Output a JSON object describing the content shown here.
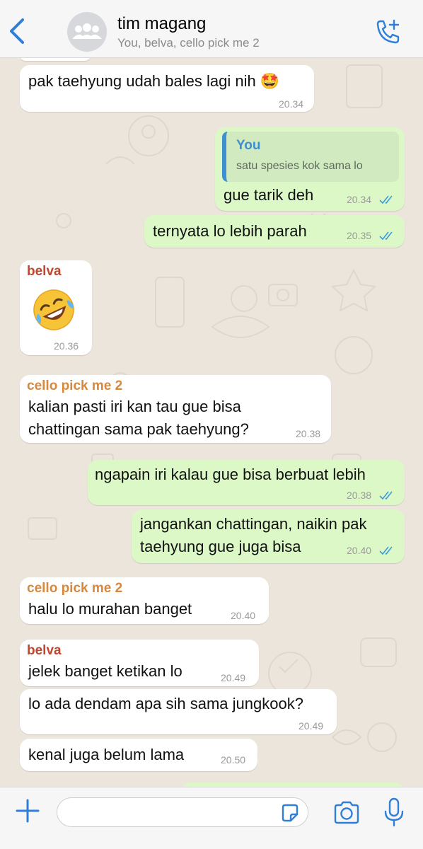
{
  "header": {
    "back_icon": "chevron-left-icon",
    "title": "tim magang",
    "subtitle": "You, belva, cello pick me 2",
    "avatar_icon": "group-icon",
    "call_icon": "add-call-icon",
    "accent": "#2f7fd9"
  },
  "messages": [
    {
      "dir": "in",
      "text": "pak taehyung udah bales lagi nih 🤩",
      "time": "20.34"
    },
    {
      "dir": "out",
      "quote_name": "You",
      "quote_text": "satu spesies kok sama lo",
      "text": "gue tarik deh",
      "time": "20.34",
      "read": true
    },
    {
      "dir": "out",
      "text": "ternyata lo lebih parah",
      "time": "20.35",
      "read": true
    },
    {
      "dir": "in",
      "sender": "belva",
      "sender_color": "#c0462e",
      "emoji": "rolling-on-floor-laughing",
      "time": "20.36"
    },
    {
      "dir": "in",
      "sender": "cello pick me 2",
      "sender_color": "#d9873a",
      "line1": "kalian pasti iri kan tau gue bisa",
      "line2": "chattingan sama pak taehyung?",
      "time": "20.38"
    },
    {
      "dir": "out",
      "text": "ngapain iri kalau gue bisa berbuat lebih",
      "time": "20.38",
      "read": true
    },
    {
      "dir": "out",
      "line1": "jangankan chattingan, naikin pak",
      "line2": "taehyung gue juga bisa",
      "time": "20.40",
      "read": true
    },
    {
      "dir": "in",
      "sender": "cello pick me 2",
      "sender_color": "#d9873a",
      "text": "halu lo murahan banget",
      "time": "20.40"
    },
    {
      "dir": "in",
      "sender": "belva",
      "sender_color": "#c0462e",
      "text": "jelek banget ketikan lo",
      "time": "20.49"
    },
    {
      "dir": "in",
      "text": "lo ada dendam apa sih sama jungkook?",
      "time": "20.49"
    },
    {
      "dir": "in",
      "text": "kenal juga belum lama",
      "time": "20.50"
    }
  ],
  "composer": {
    "placeholder": "",
    "plus_icon": "plus-icon",
    "sticker_icon": "sticker-icon",
    "camera_icon": "camera-icon",
    "mic_icon": "microphone-icon"
  }
}
